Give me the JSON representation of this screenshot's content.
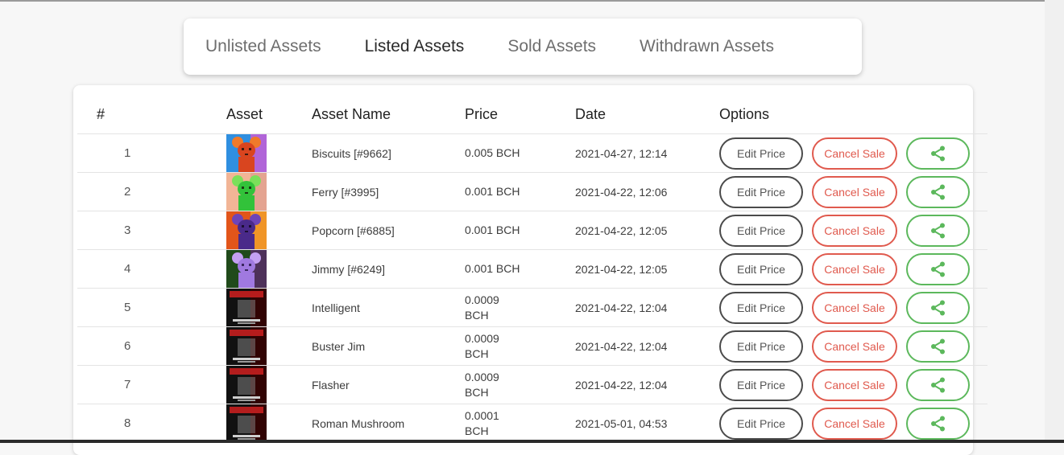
{
  "tabs": [
    {
      "label": "Unlisted Assets",
      "active": false
    },
    {
      "label": "Listed Assets",
      "active": true
    },
    {
      "label": "Sold Assets",
      "active": false
    },
    {
      "label": "Withdrawn Assets",
      "active": false
    }
  ],
  "table": {
    "headers": {
      "num": "#",
      "asset": "Asset",
      "name": "Asset Name",
      "price": "Price",
      "date": "Date",
      "options": "Options"
    },
    "rows": [
      {
        "num": "1",
        "name": "Biscuits [#9662]",
        "price_line1": "0.005 BCH",
        "price_line2": "",
        "date": "2021-04-27, 12:14",
        "thumb": "rat-red"
      },
      {
        "num": "2",
        "name": "Ferry [#3995]",
        "price_line1": "0.001 BCH",
        "price_line2": "",
        "date": "2021-04-22, 12:06",
        "thumb": "rat-green"
      },
      {
        "num": "3",
        "name": "Popcorn [#6885]",
        "price_line1": "0.001 BCH",
        "price_line2": "",
        "date": "2021-04-22, 12:05",
        "thumb": "rat-purple-fire"
      },
      {
        "num": "4",
        "name": "Jimmy [#6249]",
        "price_line1": "0.001 BCH",
        "price_line2": "",
        "date": "2021-04-22, 12:05",
        "thumb": "rat-lilac"
      },
      {
        "num": "5",
        "name": "Intelligent",
        "price_line1": "0.0009",
        "price_line2": "BCH",
        "date": "2021-04-22, 12:04",
        "thumb": "poster-dark"
      },
      {
        "num": "6",
        "name": "Buster Jim",
        "price_line1": "0.0009",
        "price_line2": "BCH",
        "date": "2021-04-22, 12:04",
        "thumb": "poster-dark"
      },
      {
        "num": "7",
        "name": "Flasher",
        "price_line1": "0.0009",
        "price_line2": "BCH",
        "date": "2021-04-22, 12:04",
        "thumb": "poster-dark"
      },
      {
        "num": "8",
        "name": "Roman Mushroom",
        "price_line1": "0.0001",
        "price_line2": "BCH",
        "date": "2021-05-01, 04:53",
        "thumb": "poster-dark"
      }
    ]
  },
  "options": {
    "edit_label": "Edit Price",
    "cancel_label": "Cancel Sale",
    "share_icon": "share-icon"
  },
  "colors": {
    "cancel": "#e05a4e",
    "share": "#5cb85c",
    "edit": "#4a4a4a"
  }
}
